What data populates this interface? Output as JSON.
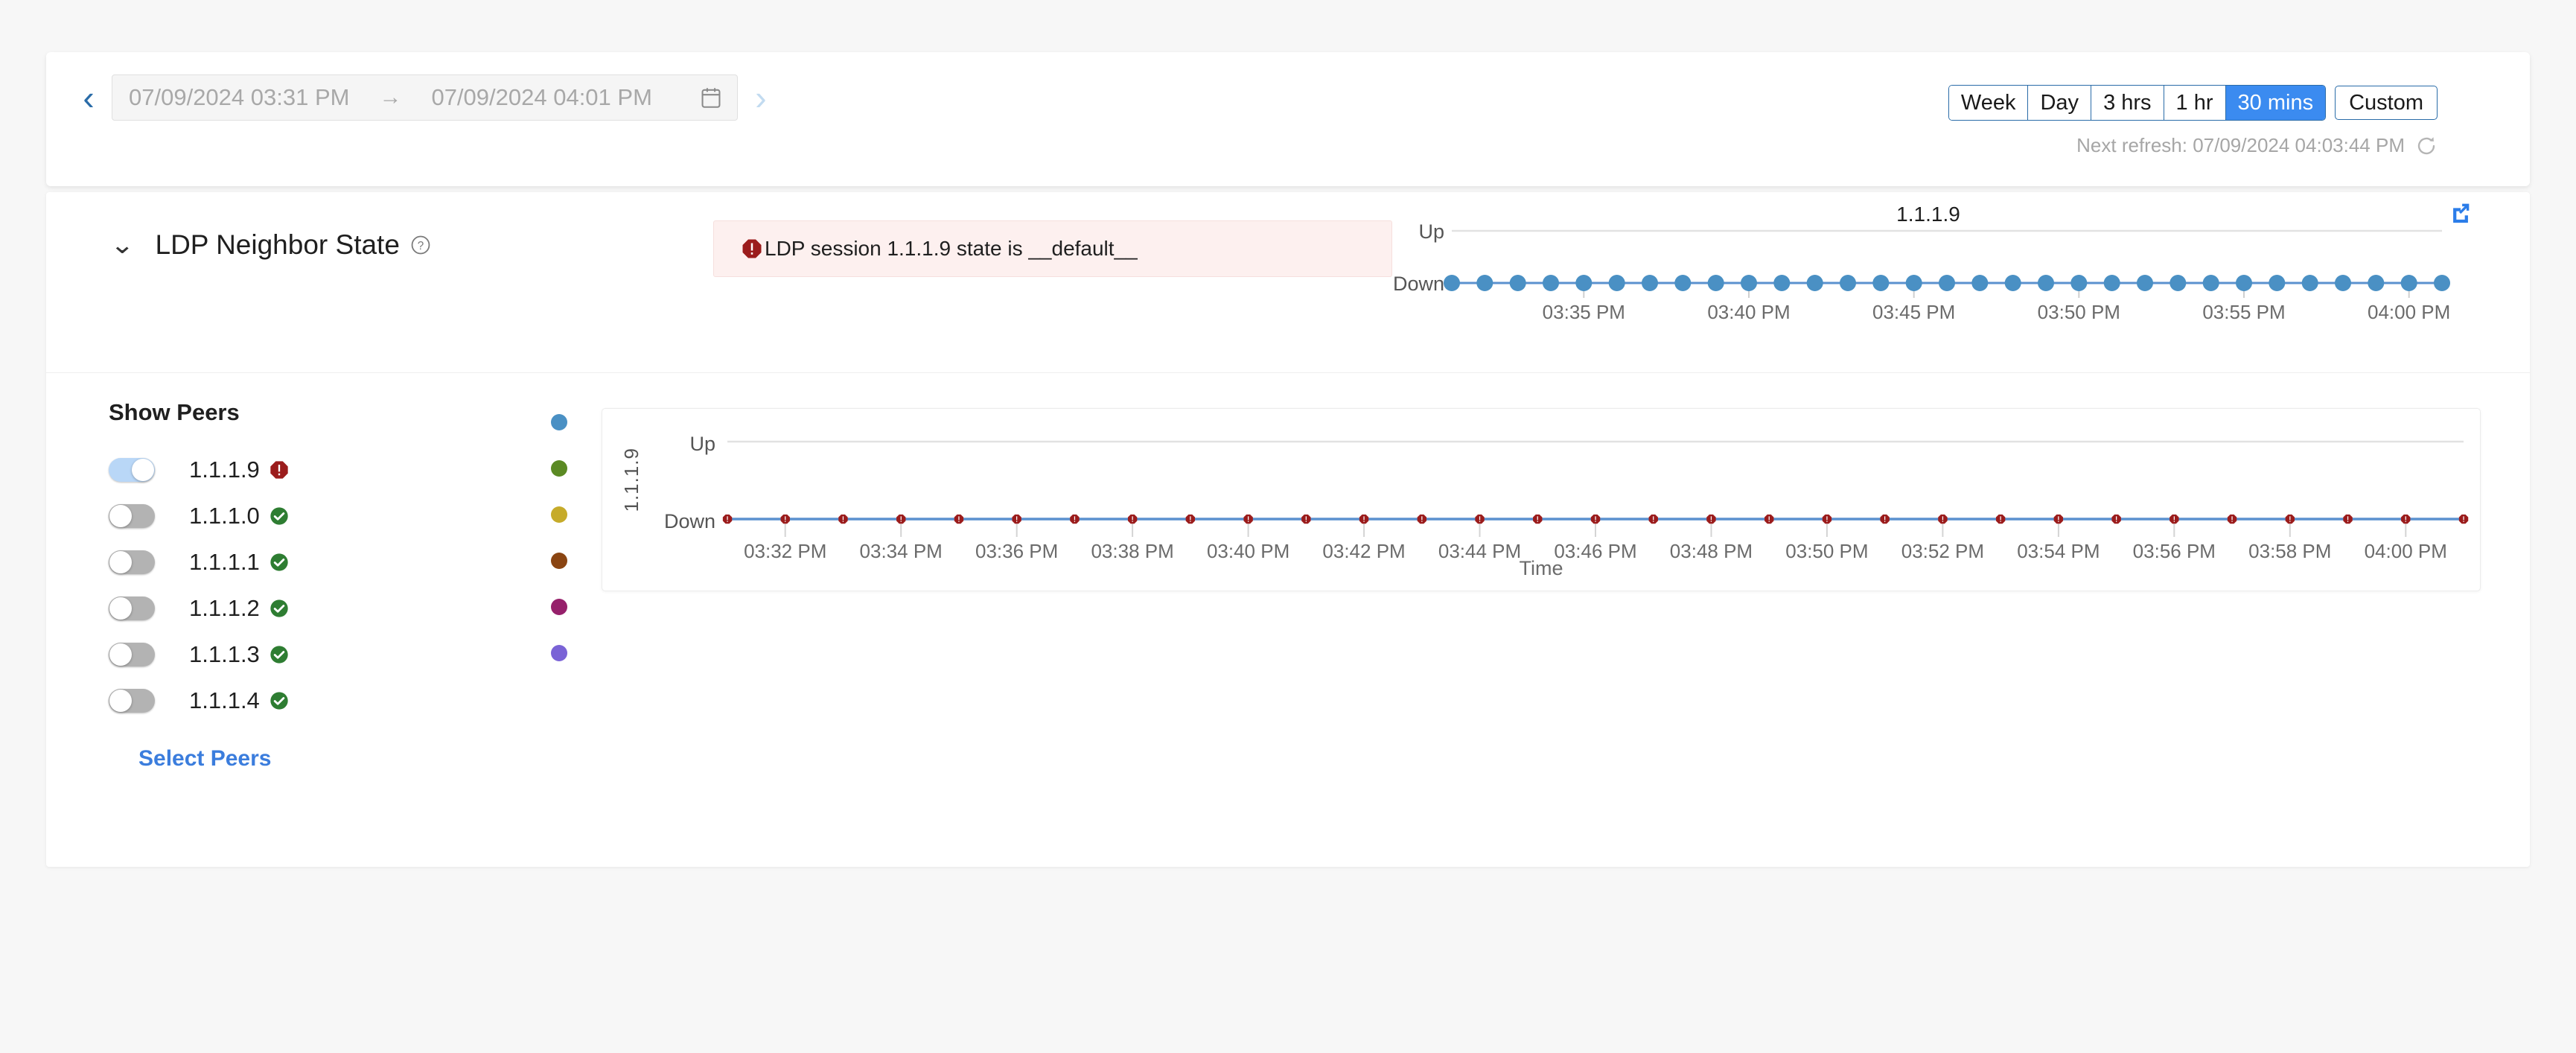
{
  "time_range": {
    "start": "07/09/2024 03:31 PM",
    "end": "07/09/2024 04:01 PM",
    "arrow": "→",
    "prev_label": "‹",
    "next_label": "›"
  },
  "quick_ranges": {
    "options": [
      "Week",
      "Day",
      "3 hrs",
      "1 hr",
      "30 mins"
    ],
    "active": "30 mins",
    "custom_label": "Custom"
  },
  "refresh": {
    "text": "Next refresh: 07/09/2024 04:03:44 PM"
  },
  "section": {
    "title": "LDP Neighbor State",
    "collapse_chevron": "⌄"
  },
  "alert": {
    "message": "LDP session 1.1.1.9 state is __default__",
    "color": "#9b1c1c",
    "bg": "#fdf0ef"
  },
  "mini_chart": {
    "title": "1.1.1.9",
    "y_top": "Up",
    "y_bottom": "Down",
    "tick_labels": [
      "03:35 PM",
      "03:40 PM",
      "03:45 PM",
      "03:50 PM",
      "03:55 PM",
      "04:00 PM"
    ]
  },
  "peers_panel": {
    "title": "Show Peers",
    "select_peers_label": "Select Peers",
    "peers": [
      {
        "name": "1.1.1.9",
        "toggle": "on",
        "status": "alert",
        "color": "#4a90c4"
      },
      {
        "name": "1.1.1.0",
        "toggle": "off",
        "status": "ok",
        "color": "#5b8a24"
      },
      {
        "name": "1.1.1.1",
        "toggle": "off",
        "status": "ok",
        "color": "#c6ab2a"
      },
      {
        "name": "1.1.1.2",
        "toggle": "off",
        "status": "ok",
        "color": "#8a4512"
      },
      {
        "name": "1.1.1.3",
        "toggle": "off",
        "status": "ok",
        "color": "#96206b"
      },
      {
        "name": "1.1.1.4",
        "toggle": "off",
        "status": "ok",
        "color": "#7a63d6"
      }
    ]
  },
  "main_chart": {
    "y_axis_title": "1.1.1.9",
    "x_axis_title": "Time",
    "y_top": "Up",
    "y_bottom": "Down"
  },
  "chart_data": [
    {
      "type": "line",
      "id": "mini-chart-1119",
      "title": "1.1.1.9",
      "xlabel": "",
      "ylabel": "",
      "ycategories": [
        "Down",
        "Up"
      ],
      "ylim": [
        0,
        1
      ],
      "grid": false,
      "legend": "none",
      "marker": "circle",
      "line_color": "#4a90c4",
      "marker_color": "#4a90c4",
      "x_tick_labels": [
        "03:35 PM",
        "03:40 PM",
        "03:45 PM",
        "03:50 PM",
        "03:55 PM",
        "04:00 PM"
      ],
      "x": [
        "03:31 PM",
        "03:32 PM",
        "03:33 PM",
        "03:34 PM",
        "03:35 PM",
        "03:36 PM",
        "03:37 PM",
        "03:38 PM",
        "03:39 PM",
        "03:40 PM",
        "03:41 PM",
        "03:42 PM",
        "03:43 PM",
        "03:44 PM",
        "03:45 PM",
        "03:46 PM",
        "03:47 PM",
        "03:48 PM",
        "03:49 PM",
        "03:50 PM",
        "03:51 PM",
        "03:52 PM",
        "03:53 PM",
        "03:54 PM",
        "03:55 PM",
        "03:56 PM",
        "03:57 PM",
        "03:58 PM",
        "03:59 PM",
        "04:00 PM",
        "04:01 PM"
      ],
      "values": [
        "Down",
        "Down",
        "Down",
        "Down",
        "Down",
        "Down",
        "Down",
        "Down",
        "Down",
        "Down",
        "Down",
        "Down",
        "Down",
        "Down",
        "Down",
        "Down",
        "Down",
        "Down",
        "Down",
        "Down",
        "Down",
        "Down",
        "Down",
        "Down",
        "Down",
        "Down",
        "Down",
        "Down",
        "Down",
        "Down",
        "Down"
      ]
    },
    {
      "type": "line",
      "id": "main-chart-1119",
      "title": "",
      "xlabel": "Time",
      "ylabel": "1.1.1.9",
      "ycategories": [
        "Down",
        "Up"
      ],
      "ylim": [
        0,
        1
      ],
      "grid": false,
      "legend": "none",
      "marker": "alert-octagon",
      "line_color": "#5b91cf",
      "marker_color": "#9b1c1c",
      "x_tick_labels": [
        "03:32 PM",
        "03:34 PM",
        "03:36 PM",
        "03:38 PM",
        "03:40 PM",
        "03:42 PM",
        "03:44 PM",
        "03:46 PM",
        "03:48 PM",
        "03:50 PM",
        "03:52 PM",
        "03:54 PM",
        "03:56 PM",
        "03:58 PM",
        "04:00 PM"
      ],
      "x": [
        "03:31 PM",
        "03:32 PM",
        "03:33 PM",
        "03:34 PM",
        "03:35 PM",
        "03:36 PM",
        "03:37 PM",
        "03:38 PM",
        "03:39 PM",
        "03:40 PM",
        "03:41 PM",
        "03:42 PM",
        "03:43 PM",
        "03:44 PM",
        "03:45 PM",
        "03:46 PM",
        "03:47 PM",
        "03:48 PM",
        "03:49 PM",
        "03:50 PM",
        "03:51 PM",
        "03:52 PM",
        "03:53 PM",
        "03:54 PM",
        "03:55 PM",
        "03:56 PM",
        "03:57 PM",
        "03:58 PM",
        "03:59 PM",
        "04:00 PM",
        "04:01 PM"
      ],
      "values": [
        "Down",
        "Down",
        "Down",
        "Down",
        "Down",
        "Down",
        "Down",
        "Down",
        "Down",
        "Down",
        "Down",
        "Down",
        "Down",
        "Down",
        "Down",
        "Down",
        "Down",
        "Down",
        "Down",
        "Down",
        "Down",
        "Down",
        "Down",
        "Down",
        "Down",
        "Down",
        "Down",
        "Down",
        "Down",
        "Down",
        "Down"
      ]
    }
  ]
}
